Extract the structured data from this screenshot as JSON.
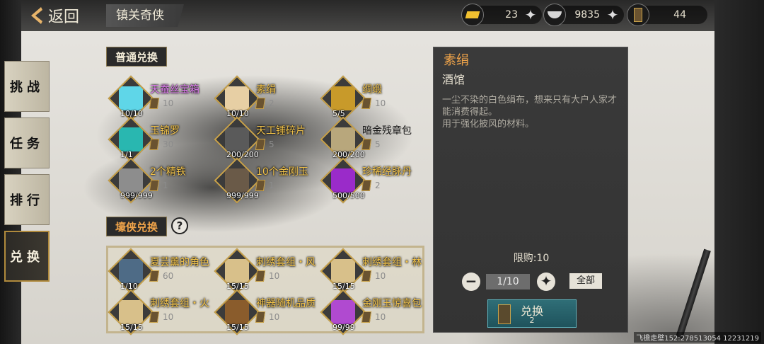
{
  "header": {
    "back_label": "返回",
    "title": "镇关奇侠",
    "resources": [
      {
        "icon": "gold-bar-icon",
        "value": "23"
      },
      {
        "icon": "silver-ingot-icon",
        "value": "9835"
      },
      {
        "icon": "token-icon",
        "value": "44"
      }
    ]
  },
  "nav": {
    "tabs": [
      "挑战",
      "任务",
      "排行",
      "兑换"
    ],
    "active": "兑换"
  },
  "normal_exchange": {
    "title": "普通兑换",
    "items": [
      {
        "name": "天蚕丝宝箱",
        "cost": "10",
        "count": "10/10",
        "style": "purple",
        "color": "#5fd6e8"
      },
      {
        "name": "素绢",
        "cost": "2",
        "count": "10/10",
        "style": "gold",
        "color": "#e7cfa4"
      },
      {
        "name": "绸缎",
        "cost": "10",
        "count": "5/5",
        "style": "gold",
        "color": "#c89a2a"
      },
      {
        "name": "玉锦罗",
        "cost": "30",
        "count": "1/1",
        "style": "gold",
        "color": "#29b7b0"
      },
      {
        "name": "天工锤碎片",
        "cost": "5",
        "count": "200/200",
        "style": "gold",
        "color": "#5a5a5a"
      },
      {
        "name": "暗金残章包",
        "cost": "5",
        "count": "200/200",
        "style": "dark",
        "color": "#b8a77c"
      },
      {
        "name": "2个精铁",
        "cost": "1",
        "count": "999/999",
        "style": "gold",
        "color": "#8d8d8d"
      },
      {
        "name": "10个金刚玉",
        "cost": "1",
        "count": "999/999",
        "style": "gold",
        "color": "#6a5a48"
      },
      {
        "name": "珍稀经脉丹",
        "cost": "2",
        "count": "500/500",
        "style": "gold",
        "color": "#9a2bc9"
      }
    ]
  },
  "xia_exchange": {
    "title": "壕侠兑换",
    "help": "?",
    "items": [
      {
        "name": "夏芸薰的角色",
        "cost": "60",
        "count": "1/10",
        "color": "#4e6b86"
      },
      {
        "name": "刺绣套组・风",
        "cost": "10",
        "count": "15/15",
        "color": "#d8c08a"
      },
      {
        "name": "刺绣套组・林",
        "cost": "10",
        "count": "15/15",
        "color": "#d8c08a"
      },
      {
        "name": "刺绣套组・火",
        "cost": "10",
        "count": "15/15",
        "color": "#d8c08a"
      },
      {
        "name": "神器随机品质",
        "cost": "10",
        "count": "15/15",
        "color": "#8a5c2c"
      },
      {
        "name": "金刚玉惊喜包",
        "cost": "10",
        "count": "99/99",
        "color": "#b04ad0"
      }
    ]
  },
  "detail": {
    "title": "素绢",
    "subtitle": "酒馆",
    "description": "一尘不染的白色绢布，想来只有大户人家才能消费得起。\n用于强化披风的材料。",
    "limit": "限购:10",
    "quantity": "1/10",
    "all_label": "全部",
    "exchange_label": "兑换",
    "exchange_cost": "2"
  },
  "footer": {
    "id_text": "飞檐走壁152:278513054  12231219"
  }
}
